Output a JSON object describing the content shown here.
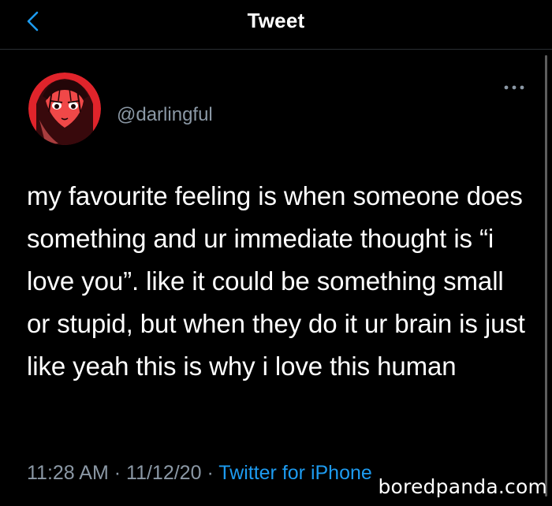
{
  "header": {
    "title": "Tweet",
    "back_icon": "chevron-left-icon"
  },
  "author": {
    "handle": "@darlingful",
    "avatar": "anime-avatar"
  },
  "tweet": {
    "text": "my favourite feeling is when someone does something and ur immediate thought is “i love you”. like it could be something small or stupid, but when they do it ur brain is just like yeah this is why i love this human",
    "time": "11:28 AM",
    "separator": "·",
    "date": "11/12/20",
    "source": "Twitter for iPhone"
  },
  "watermark": "boredpanda.com",
  "colors": {
    "background": "#000000",
    "accent": "#1d9bf0",
    "muted": "#8b98a5"
  }
}
